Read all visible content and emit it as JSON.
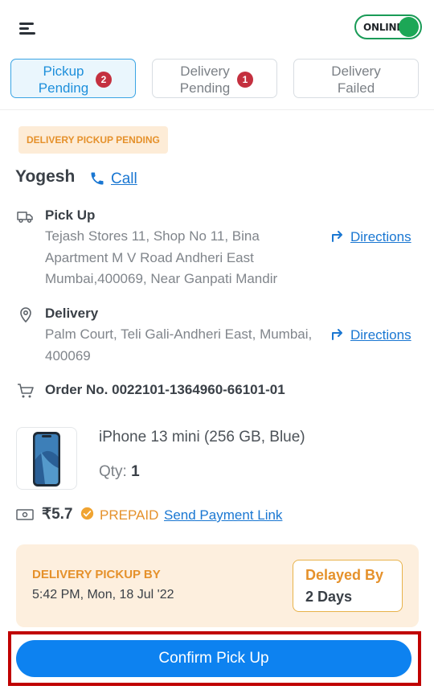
{
  "header": {
    "menu_icon": "hamburger-menu-icon",
    "online_toggle": {
      "label": "ONLINE",
      "state": true,
      "color": "#1ca756"
    }
  },
  "tabs": [
    {
      "label_line1": "Pickup",
      "label_line2": "Pending",
      "badge": "2",
      "active": true
    },
    {
      "label_line1": "Delivery",
      "label_line2": "Pending",
      "badge": "1",
      "active": false
    },
    {
      "label_line1": "Delivery",
      "label_line2": "Failed",
      "badge": "",
      "active": false
    }
  ],
  "order": {
    "status_chip": "DELIVERY PICKUP PENDING",
    "customer_name": "Yogesh",
    "call_label": "Call",
    "pickup": {
      "title": "Pick Up",
      "address": "Tejash Stores 11, Shop No 11, Bina Apartment M V Road Andheri East Mumbai,400069, Near Ganpati Mandir",
      "directions_label": "Directions"
    },
    "delivery": {
      "title": "Delivery",
      "address": "Palm Court, Teli Gali-Andheri East, Mumbai, 400069",
      "directions_label": "Directions"
    },
    "order_number_label": "Order No. 0022101-1364960-66101-01",
    "product": {
      "name": "iPhone 13 mini (256 GB, Blue)",
      "qty_label": "Qty:",
      "qty_value": "1"
    },
    "payment": {
      "amount": "₹5.7",
      "mode": "PREPAID",
      "send_link_label": "Send Payment Link"
    },
    "pickup_by": {
      "label": "DELIVERY PICKUP BY",
      "time": "5:42 PM, Mon, 18 Jul '22",
      "delay_label": "Delayed By",
      "delay_value": "2 Days"
    },
    "confirm_button_label": "Confirm Pick Up"
  },
  "colors": {
    "accent_blue": "#0d82f0",
    "link_blue": "#1a77d2",
    "warning_orange": "#e5912b",
    "badge_red": "#c4303f",
    "highlight_red": "#c00000"
  }
}
